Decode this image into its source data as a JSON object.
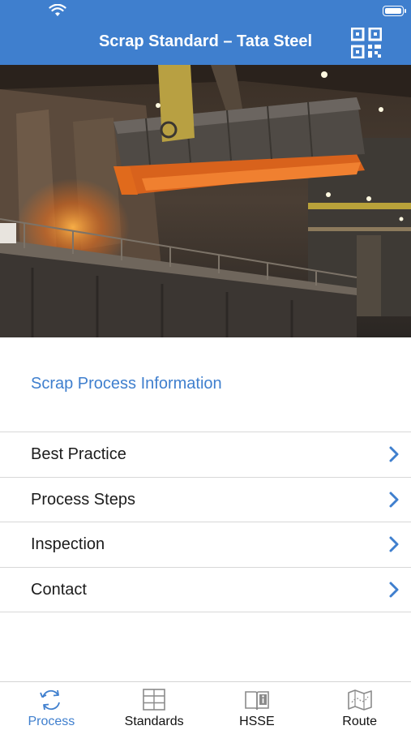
{
  "nav": {
    "title": "Scrap Standard – Tata Steel",
    "qr_icon": "qr-code-icon"
  },
  "hero": {
    "image_subject": "steel plant interior with overhead crane"
  },
  "section": {
    "title": "Scrap Process Information"
  },
  "menu": {
    "items": [
      {
        "label": "Best Practice"
      },
      {
        "label": "Process Steps"
      },
      {
        "label": "Inspection"
      },
      {
        "label": "Contact"
      }
    ]
  },
  "tabs": [
    {
      "label": "Process",
      "icon": "refresh-arrows-icon",
      "active": true
    },
    {
      "label": "Standards",
      "icon": "grid-table-icon",
      "active": false
    },
    {
      "label": "HSSE",
      "icon": "info-book-icon",
      "active": false
    },
    {
      "label": "Route",
      "icon": "map-icon",
      "active": false
    }
  ],
  "colors": {
    "accent": "#3f7fce",
    "text": "#1c1c1c",
    "divider": "#d8d8d8"
  }
}
